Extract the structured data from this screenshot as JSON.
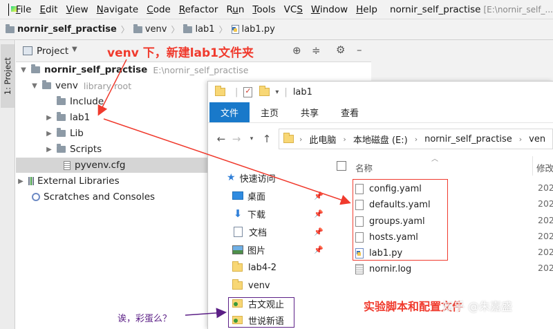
{
  "menubar": {
    "items": [
      "File",
      "Edit",
      "View",
      "Navigate",
      "Code",
      "Refactor",
      "Run",
      "Tools",
      "VCS",
      "Window",
      "Help"
    ],
    "mnemonics": [
      "F",
      "E",
      "V",
      "N",
      "C",
      "R",
      "u",
      "T",
      "S",
      "W",
      "H"
    ],
    "window_title": "nornir_self_practise",
    "window_path": "[E:\\nornir_self_..."
  },
  "breadcrumb": [
    "nornir_self_practise",
    "venv",
    "lab1",
    "lab1.py"
  ],
  "side_panel": {
    "tab_label": "1: Project"
  },
  "project_panel": {
    "view_label": "Project"
  },
  "tree": {
    "root": {
      "label": "nornir_self_practise",
      "path": "E:\\nornir_self_practise"
    },
    "venv": {
      "label": "venv",
      "hint": "library root"
    },
    "children": [
      "Include",
      "lab1",
      "Lib",
      "Scripts",
      "pyvenv.cfg"
    ],
    "external_libraries": "External Libraries",
    "scratches": "Scratches and Consoles"
  },
  "annotations": {
    "top": "venv 下，新建lab1文件夹",
    "bottom": "实验脚本和配置文件",
    "egg": "诶，彩蛋么？",
    "watermark": "知乎 @朱嘉盛"
  },
  "explorer": {
    "title": "lab1",
    "ribbon_tabs": [
      "文件",
      "主页",
      "共享",
      "查看"
    ],
    "address": [
      "此电脑",
      "本地磁盘 (E:)",
      "nornir_self_practise",
      "ven"
    ],
    "nav": [
      {
        "label": "快速访问",
        "icon": "star-icon",
        "pinned": false
      },
      {
        "label": "桌面",
        "icon": "desktop-icon",
        "pinned": true
      },
      {
        "label": "下载",
        "icon": "download-icon",
        "pinned": true
      },
      {
        "label": "文档",
        "icon": "document-icon",
        "pinned": true
      },
      {
        "label": "图片",
        "icon": "pictures-icon",
        "pinned": true
      },
      {
        "label": "lab4-2",
        "icon": "folder-icon",
        "pinned": false
      },
      {
        "label": "venv",
        "icon": "folder-icon",
        "pinned": false
      },
      {
        "label": "古文观止",
        "icon": "folder-icon",
        "pinned": false
      },
      {
        "label": "世说新语",
        "icon": "folder-icon",
        "pinned": false
      }
    ],
    "columns": {
      "name": "名称",
      "modified": "修改"
    },
    "files": [
      {
        "name": "config.yaml",
        "date": "202"
      },
      {
        "name": "defaults.yaml",
        "date": "202"
      },
      {
        "name": "groups.yaml",
        "date": "202"
      },
      {
        "name": "hosts.yaml",
        "date": "202"
      },
      {
        "name": "lab1.py",
        "date": "202"
      },
      {
        "name": "nornir.log",
        "date": "202"
      }
    ]
  },
  "colors": {
    "annotation_red": "#f03a2d",
    "egg_purple": "#5b1f86",
    "ribbon_blue": "#1979ca"
  }
}
